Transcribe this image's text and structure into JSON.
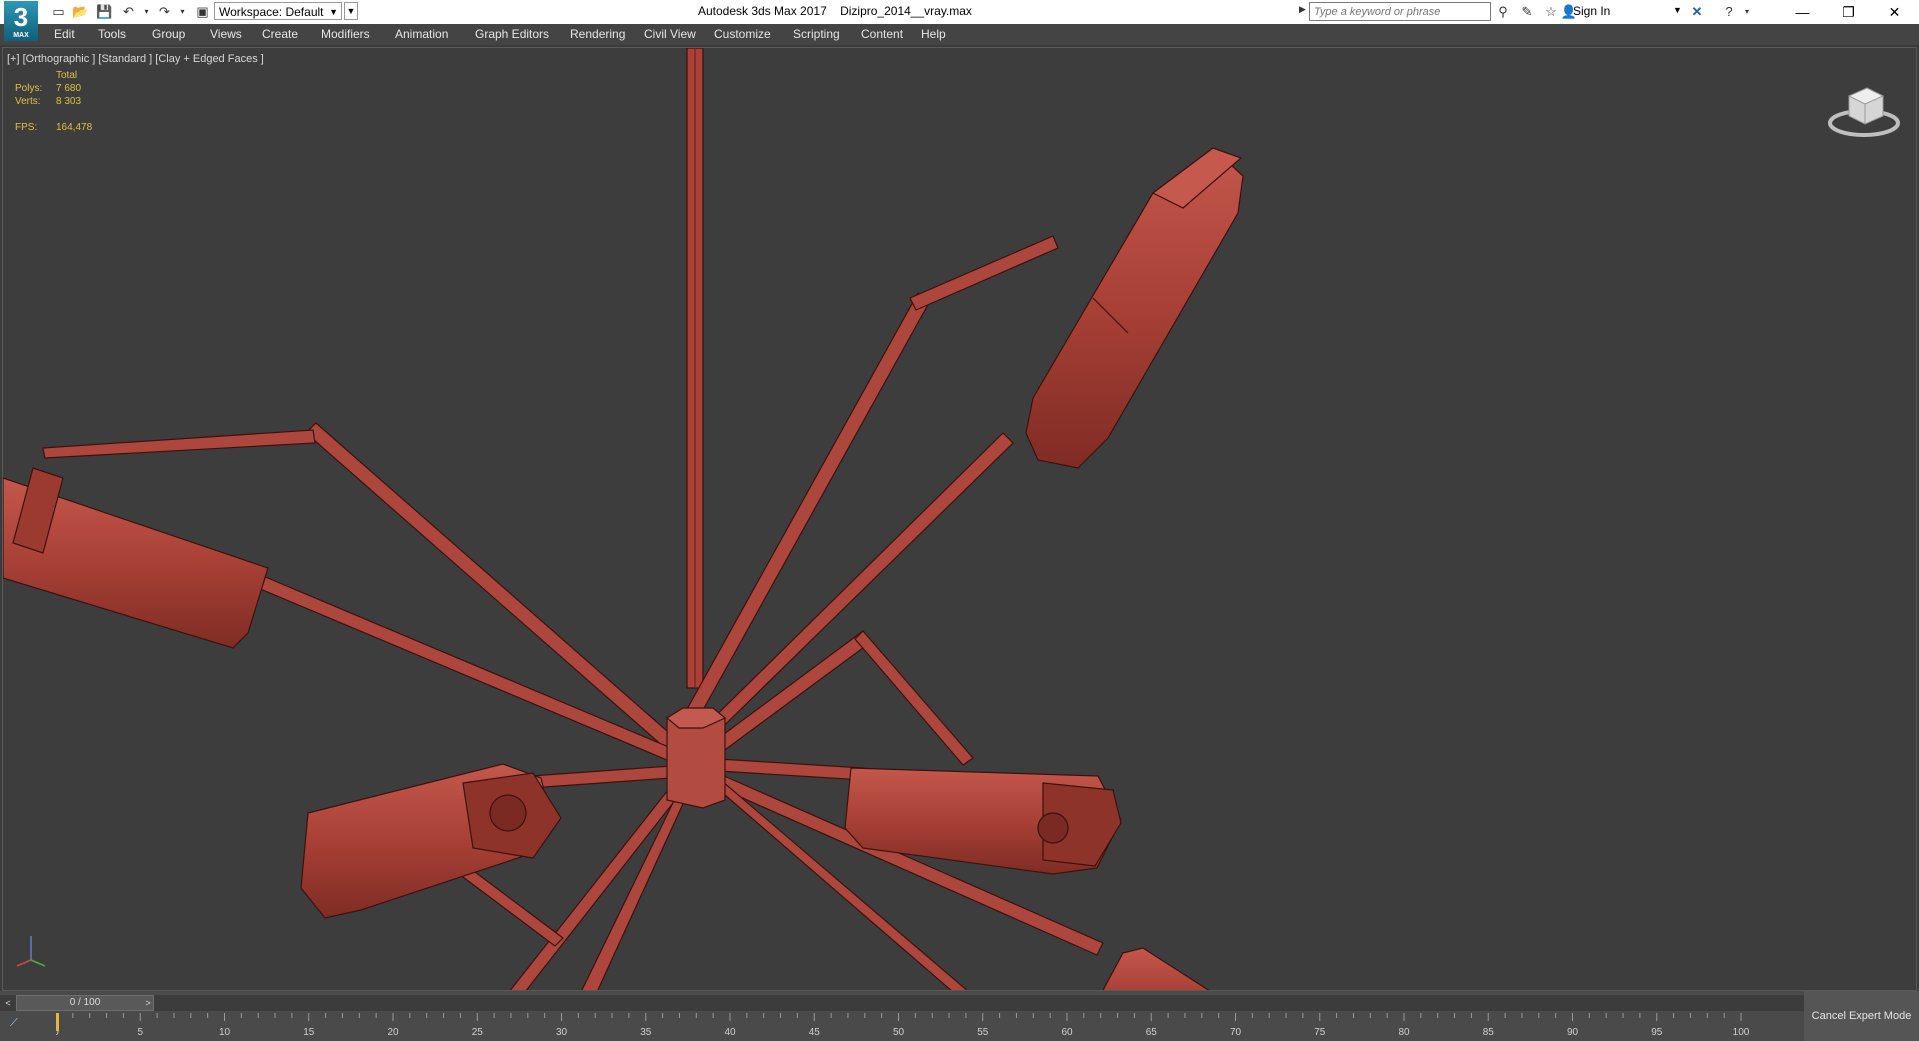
{
  "app": {
    "logo_text": "3",
    "logo_sub": "MAX",
    "title": "Autodesk 3ds Max 2017    Dizipro_2014__vray.max"
  },
  "quick_access": {
    "workspace_label": "Workspace: Default"
  },
  "search": {
    "placeholder": "Type a keyword or phrase"
  },
  "account": {
    "sign_in": "Sign In"
  },
  "window_controls": {
    "minimize": "—",
    "restore": "❐",
    "close": "✕"
  },
  "menu": {
    "items": [
      "Edit",
      "Tools",
      "Group",
      "Views",
      "Create",
      "Modifiers",
      "Animation",
      "Graph Editors",
      "Rendering",
      "Civil View",
      "Customize",
      "Scripting",
      "Content",
      "Help"
    ]
  },
  "viewport": {
    "label": "[+] [Orthographic ] [Standard ] [Clay + Edged Faces ]",
    "stats": {
      "header": "Total",
      "polys_label": "Polys:",
      "polys_value": "7 680",
      "verts_label": "Verts:",
      "verts_value": "8 303",
      "fps_label": "FPS:",
      "fps_value": "164,478"
    },
    "object_color": "#b34a40",
    "background_color": "#3d3d3d"
  },
  "timeline": {
    "frame_display": "0 / 100",
    "prev_label": "<",
    "next_label": ">",
    "ticks": [
      "0",
      "5",
      "10",
      "15",
      "20",
      "25",
      "30",
      "35",
      "40",
      "45",
      "50",
      "55",
      "60",
      "65",
      "70",
      "75",
      "80",
      "85",
      "90",
      "95",
      "100"
    ]
  },
  "status": {
    "cancel_expert_mode": "Cancel Expert Mode"
  }
}
